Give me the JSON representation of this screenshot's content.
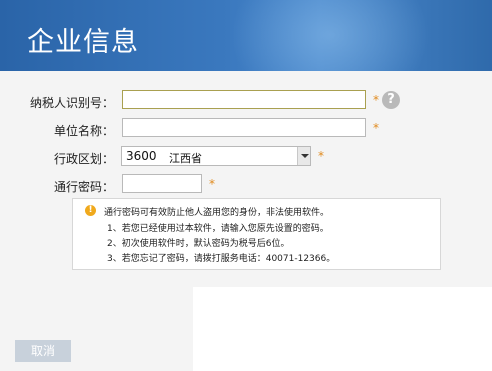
{
  "header": {
    "title": "企业信息"
  },
  "form": {
    "taxpayer_id": {
      "label": "纳税人识别号：",
      "value": ""
    },
    "company_name": {
      "label": "单位名称：",
      "value": ""
    },
    "region": {
      "label": "行政区划：",
      "code": "3600",
      "name": "江西省"
    },
    "access_password": {
      "label": "通行密码：",
      "value": ""
    },
    "required_mark": "*",
    "help_symbol": "?"
  },
  "notice": {
    "icon_symbol": "!",
    "heading": "通行密码可有效防止他人盗用您的身份，非法使用软件。",
    "items": [
      "1、若您已经使用过本软件，请输入您原先设置的密码。",
      "2、初次使用软件时，默认密码为税号后6位。",
      "3、若您忘记了密码，请拨打服务电话：40071-12366。"
    ]
  },
  "footer": {
    "cancel_label": "取消"
  },
  "colors": {
    "header_blue": "#2a64a8",
    "required_orange": "#e08a1e",
    "warning_icon": "#f0a91c",
    "cancel_button": "#c8d1db"
  }
}
